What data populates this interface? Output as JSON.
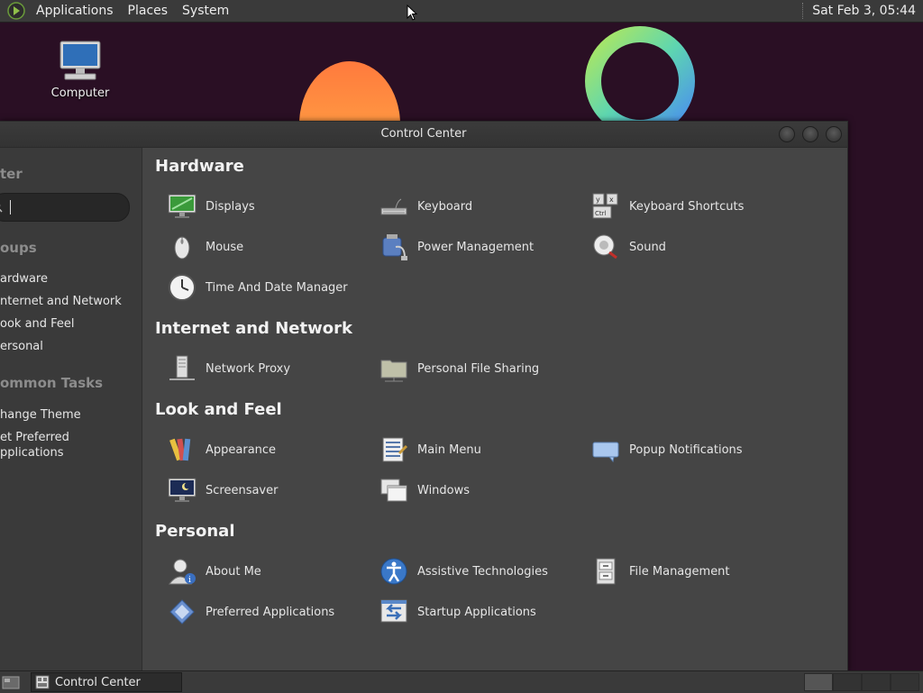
{
  "top_panel": {
    "menus": [
      "Applications",
      "Places",
      "System"
    ],
    "clock": "Sat Feb  3, 05:44"
  },
  "desktop": {
    "icons": [
      {
        "label": "Computer",
        "icon": "computer-icon"
      }
    ]
  },
  "window": {
    "title": "Control Center",
    "sidebar": {
      "title_fragment": "ter",
      "search": {
        "value": "",
        "icon": "search-icon"
      },
      "groups_heading": "oups",
      "groups": [
        "ardware",
        "nternet and Network",
        "ook and Feel",
        "ersonal"
      ],
      "tasks_heading": "ommon Tasks",
      "tasks": [
        "hange Theme",
        "et Preferred",
        "pplications"
      ]
    },
    "sections": [
      {
        "title": "Hardware",
        "items": [
          {
            "label": "Displays",
            "icon": "displays-icon"
          },
          {
            "label": "Keyboard",
            "icon": "keyboard-icon"
          },
          {
            "label": "Keyboard Shortcuts",
            "icon": "keyboard-shortcuts-icon"
          },
          {
            "label": "Mouse",
            "icon": "mouse-icon"
          },
          {
            "label": "Power Management",
            "icon": "power-management-icon"
          },
          {
            "label": "Sound",
            "icon": "sound-icon"
          },
          {
            "label": "Time And Date Manager",
            "icon": "clock-icon"
          }
        ]
      },
      {
        "title": "Internet and Network",
        "items": [
          {
            "label": "Network Proxy",
            "icon": "network-proxy-icon"
          },
          {
            "label": "Personal File Sharing",
            "icon": "folder-share-icon"
          }
        ]
      },
      {
        "title": "Look and Feel",
        "items": [
          {
            "label": "Appearance",
            "icon": "appearance-icon"
          },
          {
            "label": "Main Menu",
            "icon": "main-menu-icon"
          },
          {
            "label": "Popup Notifications",
            "icon": "popup-notifications-icon"
          },
          {
            "label": "Screensaver",
            "icon": "screensaver-icon"
          },
          {
            "label": "Windows",
            "icon": "windows-icon"
          }
        ]
      },
      {
        "title": "Personal",
        "items": [
          {
            "label": "About Me",
            "icon": "about-me-icon"
          },
          {
            "label": "Assistive Technologies",
            "icon": "accessibility-icon"
          },
          {
            "label": "File Management",
            "icon": "file-management-icon"
          },
          {
            "label": "Preferred Applications",
            "icon": "preferred-applications-icon"
          },
          {
            "label": "Startup Applications",
            "icon": "startup-applications-icon"
          }
        ]
      }
    ]
  },
  "bottom_panel": {
    "task_label": "Control Center"
  }
}
